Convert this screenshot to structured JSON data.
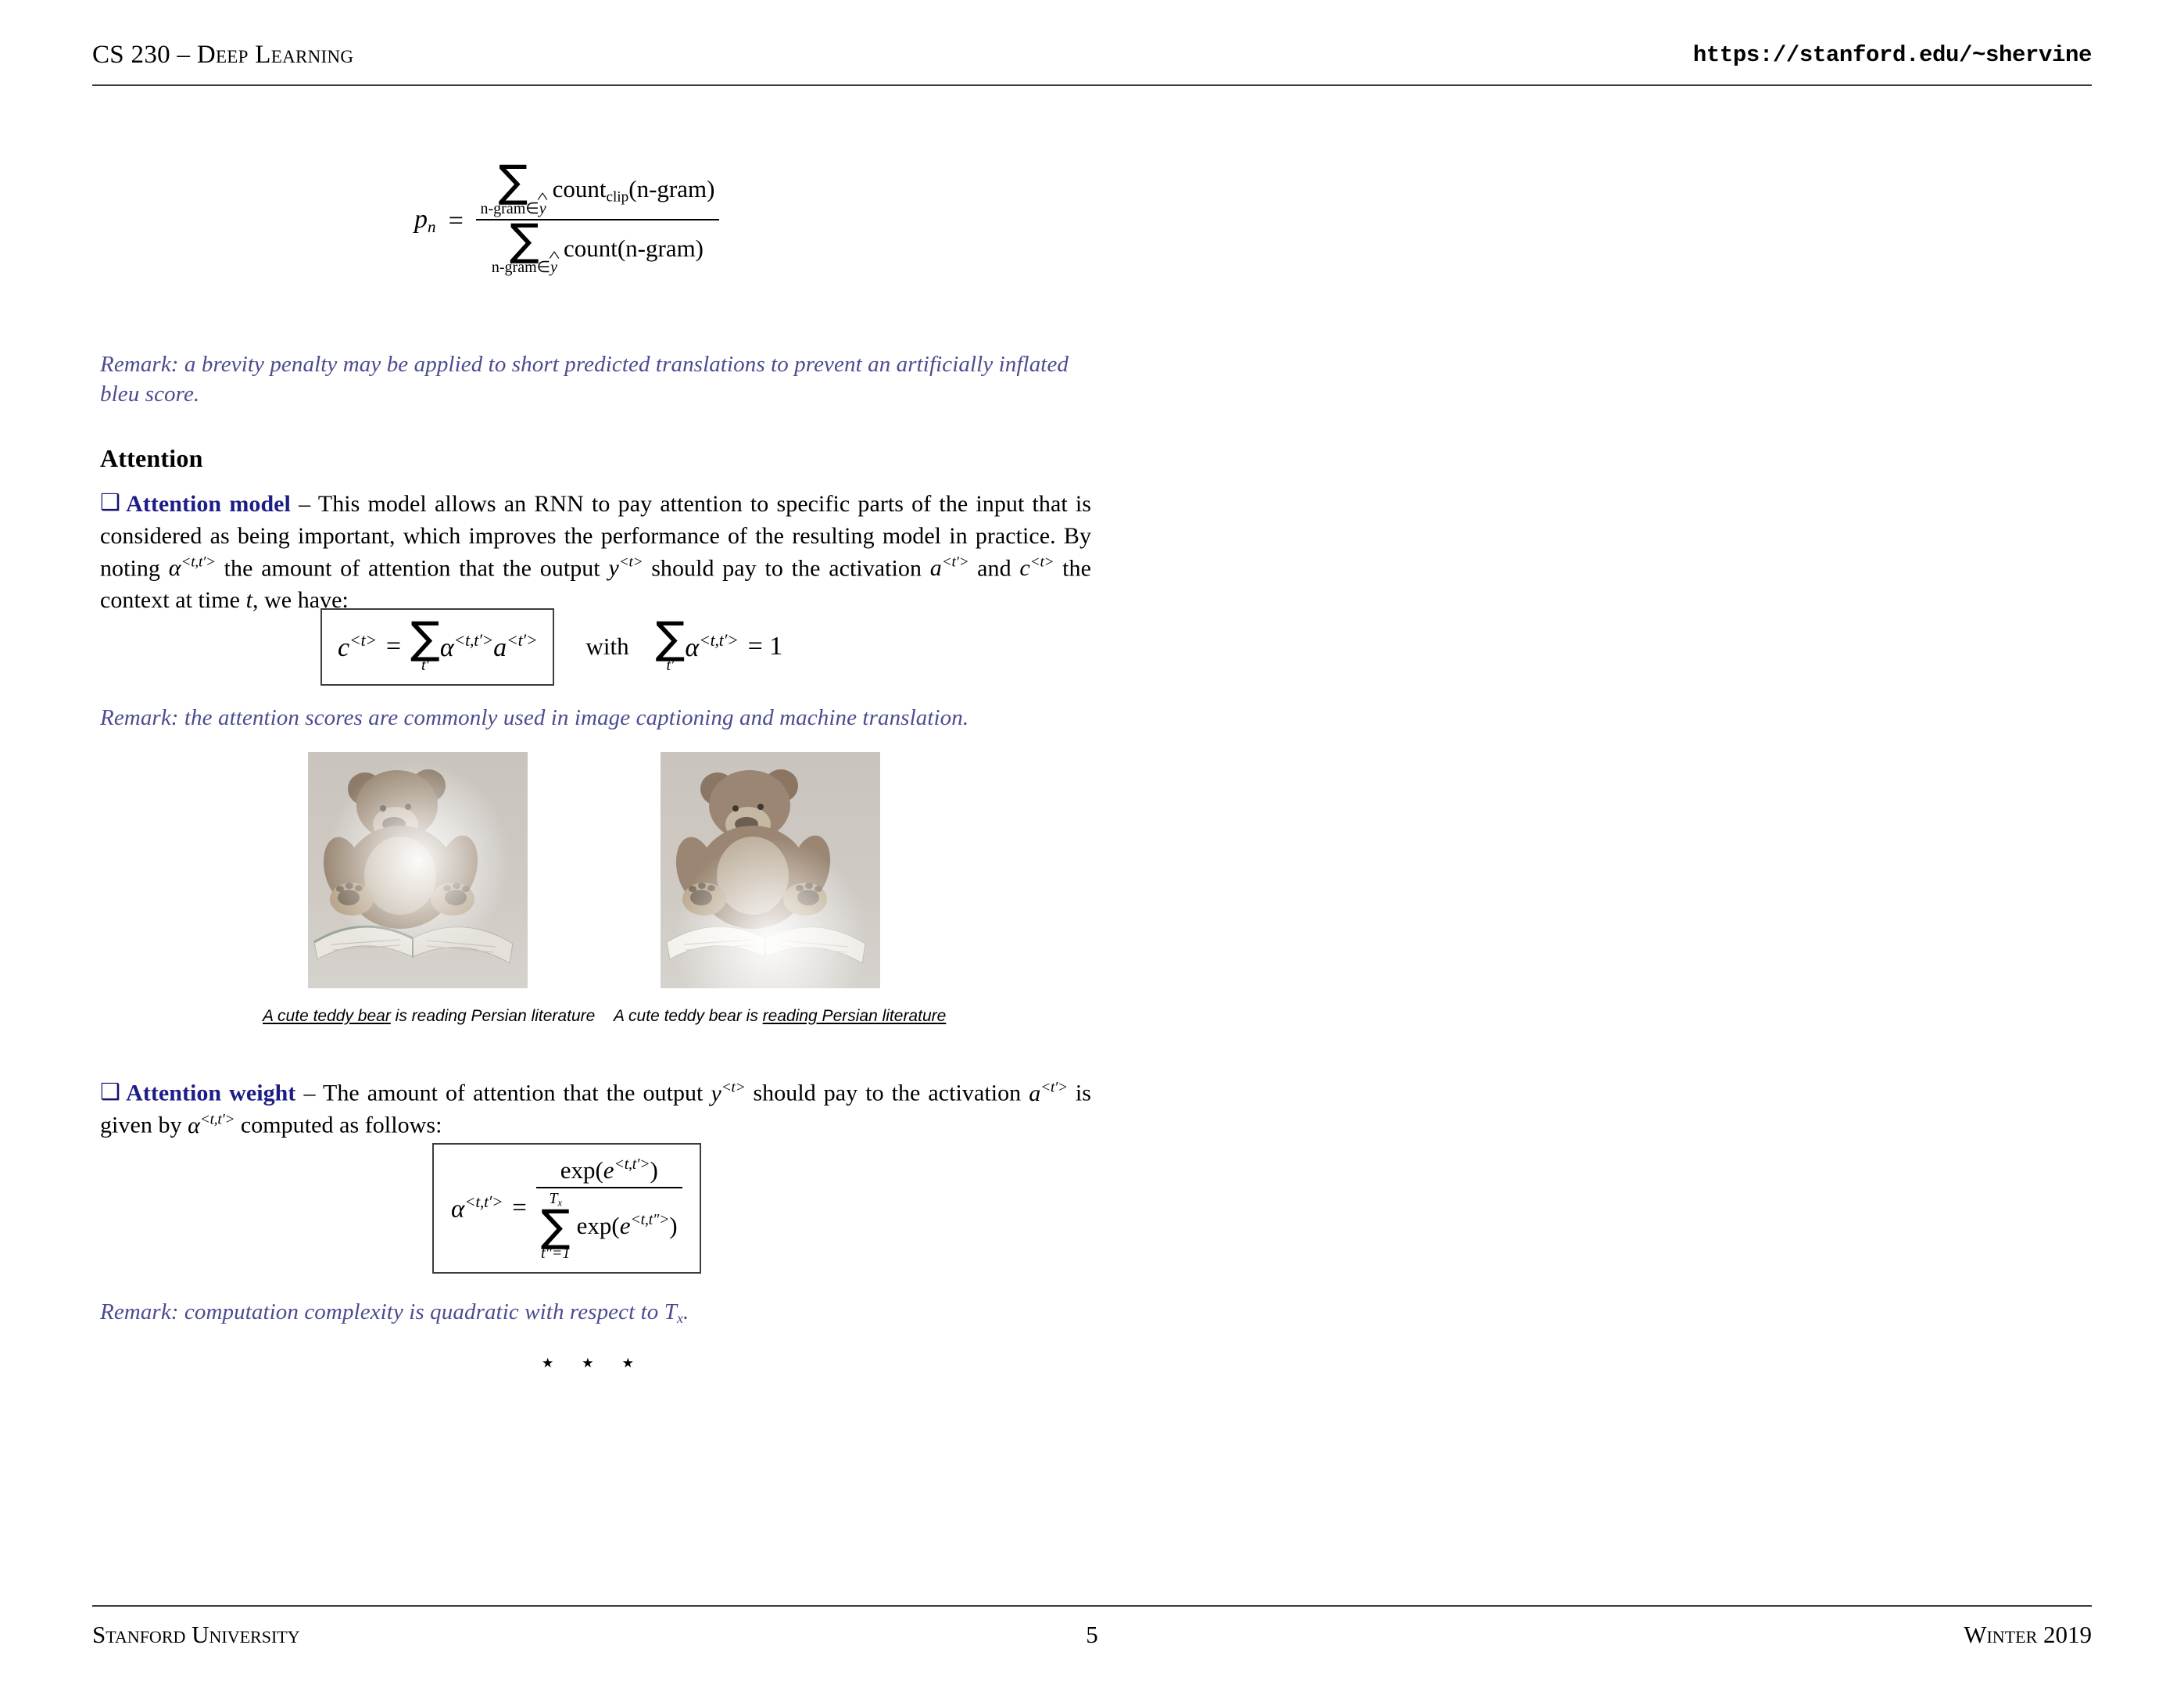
{
  "header": {
    "course": "CS 230 – Deep Learning",
    "url": "https://stanford.edu/~shervine"
  },
  "footer": {
    "institution": "Stanford University",
    "page_number": "5",
    "term": "Winter 2019"
  },
  "bleu_formula": {
    "lhs": "p",
    "lhs_sub": "n",
    "equals": "=",
    "numerator_sum_limit": "n-gram∈",
    "numerator_hat_var": "y",
    "numerator_op": "count",
    "numerator_op_sub": "clip",
    "numerator_arg": "(n-gram)",
    "denominator_sum_limit": "n-gram∈",
    "denominator_hat_var": "y",
    "denominator_op": "count",
    "denominator_arg": "(n-gram)",
    "sigma": "∑"
  },
  "remark_1": "Remark: a brevity penalty may be applied to short predicted translations to prevent an artificially inflated bleu score.",
  "section": {
    "title": "Attention"
  },
  "attention_model": {
    "bullet": "❑",
    "term": "Attention model",
    "dash": " – ",
    "text_part_1": "This model allows an RNN to pay attention to specific parts of the input that is considered as being important, which improves the performance of the resulting model in practice. By noting ",
    "alpha_symbol": "α",
    "alpha_sup": "<t,t′>",
    "text_part_2": " the amount of attention that the output ",
    "y_symbol": "y",
    "y_sup": "<t>",
    "text_part_3": " should pay to the activation ",
    "a_symbol": "a",
    "a_sup": "<t′>",
    "text_part_4": " and ",
    "c_symbol": "c",
    "c_sup": "<t>",
    "text_part_5": " the context at time ",
    "t_symbol": "t",
    "text_part_6": ", we have:"
  },
  "context_formula": {
    "c": "c",
    "c_sup": "<t>",
    "equals": "=",
    "sigma": "∑",
    "sum_index": "t′",
    "alpha": "α",
    "alpha_sup": "<t,t′>",
    "a": "a",
    "a_sup": "<t′>",
    "with": "with",
    "constraint_sigma": "∑",
    "constraint_index": "t′",
    "constraint_alpha": "α",
    "constraint_alpha_sup": "<t,t′>",
    "constraint_equals": "= 1"
  },
  "remark_2": "Remark: the attention scores are commonly used in image captioning and machine translation.",
  "figures": [
    {
      "alt": "teddy bear reading a book with attention heatmap on the bear",
      "caption_underlined": "A cute teddy bear",
      "caption_plain": " is reading Persian literature",
      "underline_position": "start"
    },
    {
      "alt": "teddy bear reading a book with attention heatmap on the book",
      "caption_plain": "A cute teddy bear is ",
      "caption_underlined": "reading Persian literature",
      "underline_position": "end"
    }
  ],
  "attention_weight": {
    "bullet": "❑",
    "term": "Attention weight",
    "dash": " – ",
    "text_part_1": "The amount of attention that the output ",
    "y_symbol": "y",
    "y_sup": "<t>",
    "text_part_2": " should pay to the activation ",
    "a_symbol": "a",
    "a_sup": "<t′>",
    "text_part_3": " is given by ",
    "alpha_symbol": "α",
    "alpha_sup": "<t,t′>",
    "text_part_4": " computed as follows:"
  },
  "weight_formula": {
    "alpha": "α",
    "alpha_sup": "<t,t′>",
    "equals": "=",
    "num_op": "exp",
    "num_e": "e",
    "num_e_sup": "<t,t′>",
    "sigma": "∑",
    "sum_upper": "T",
    "sum_upper_sub": "x",
    "sum_lower": "t″=1",
    "den_op": "exp",
    "den_e": "e",
    "den_e_sup": "<t,t″>"
  },
  "remark_3_prefix": "Remark: computation complexity is quadratic with respect to ",
  "remark_3_symbol": "T",
  "remark_3_symbol_sub": "x",
  "remark_3_suffix": ".",
  "separator": {
    "star": "⋆",
    "count": 3
  },
  "colors": {
    "remark": "#4b4b91",
    "term": "#1d1d87",
    "bullet": "#101070",
    "rule": "#3a3a3a",
    "text": "#000000"
  }
}
